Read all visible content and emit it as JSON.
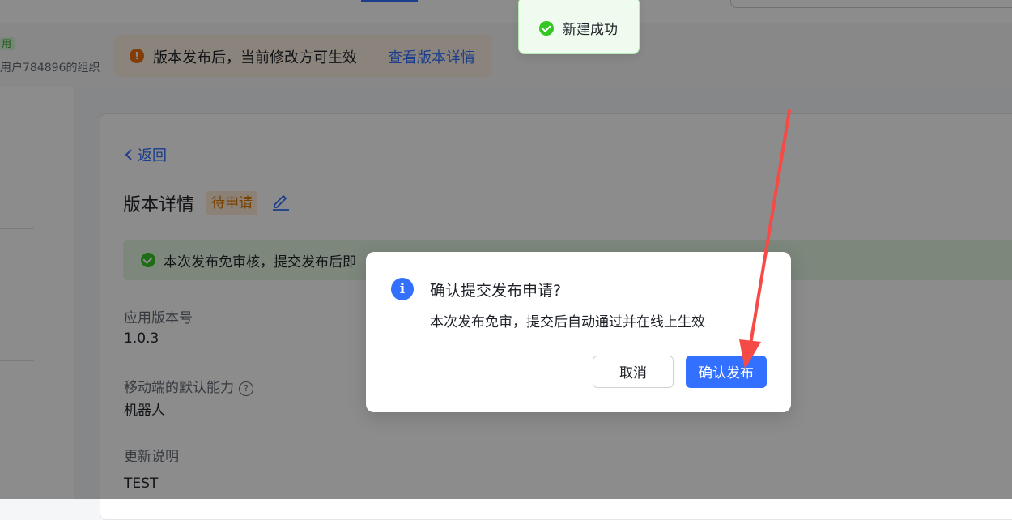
{
  "org": {
    "badge": "用",
    "name": "用户784896的组织"
  },
  "banner": {
    "icon": "warning-icon",
    "text": "版本发布后，当前修改方可生效",
    "link": "查看版本详情"
  },
  "page": {
    "back": "返回",
    "title": "版本详情",
    "status": "待申请",
    "notice": "本次发布免审核，提交发布后即"
  },
  "fields": {
    "version_label": "应用版本号",
    "version_value": "1.0.3",
    "mobile_label": "移动端的默认能力",
    "mobile_value": "机器人",
    "changelog_label": "更新说明",
    "changelog_value": "TEST"
  },
  "toast": {
    "text": "新建成功"
  },
  "dialog": {
    "title": "确认提交发布申请?",
    "body": "本次发布免审，提交后自动通过并在线上生效",
    "cancel": "取消",
    "confirm": "确认发布"
  },
  "colors": {
    "primary": "#3370ff",
    "success": "#34c724",
    "warning": "#ed6d0c",
    "annotation_arrow": "#f54a45"
  }
}
